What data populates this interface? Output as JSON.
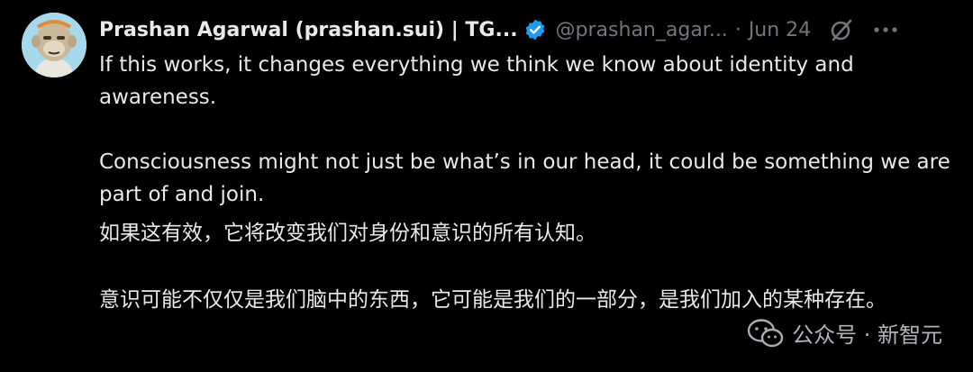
{
  "tweet": {
    "author": {
      "display_name": "Prashan Agarwal (prashan.sui) | TG...",
      "handle": "@prashan_agar...",
      "avatar": "ape-avatar"
    },
    "separator": "·",
    "date": "Jun 24",
    "icons": {
      "verified": "verified-badge-icon",
      "grok": "grok-icon",
      "more": "more-options-icon"
    },
    "colors": {
      "background": "#000000",
      "text": "#e7e9ea",
      "secondary": "#71767b",
      "verified": "#1d9bf0"
    },
    "text_en_para1": "If this works, it changes everything we think we know about identity and awareness.",
    "text_en_para2": "Consciousness might not just be what’s in our head, it could be something we are part of and join.",
    "text_zh_para1": "如果这有效，它将改变我们对身份和意识的所有认知。",
    "text_zh_para2": "意识可能不仅仅是我们脑中的东西，它可能是我们的一部分，是我们加入的某种存在。"
  },
  "watermark": {
    "text": "公众号 · 新智元",
    "icon": "wechat-icon"
  }
}
